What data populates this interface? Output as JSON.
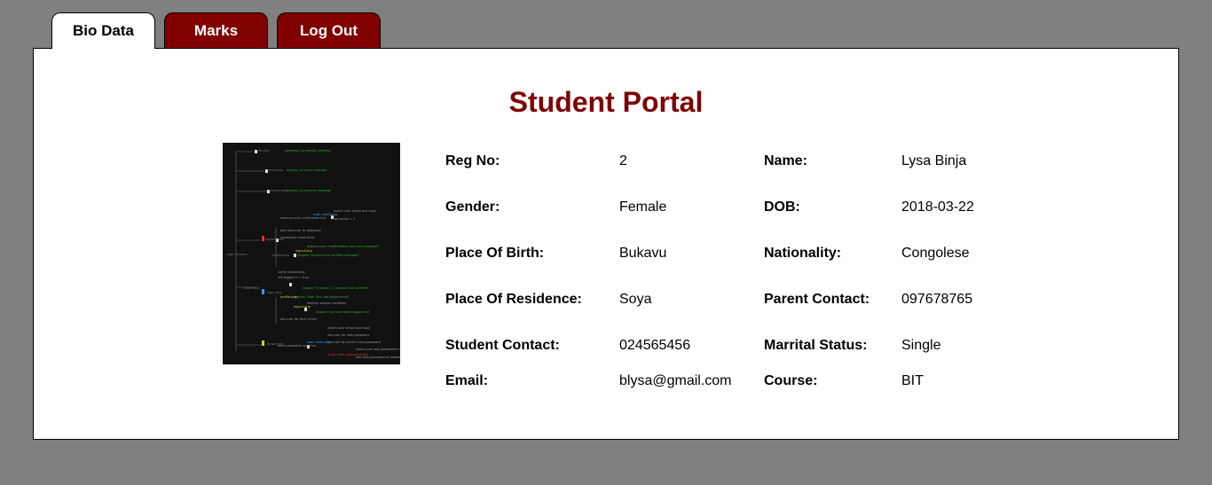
{
  "tabs": [
    {
      "label": "Bio Data",
      "active": true
    },
    {
      "label": "Marks",
      "active": false
    },
    {
      "label": "Log Out",
      "active": false
    }
  ],
  "colors": {
    "background": "#808080",
    "accent": "#800000",
    "panel": "#ffffff"
  },
  "page": {
    "title": "Student Portal"
  },
  "photo": {
    "icon": "student-photo-image"
  },
  "bio": {
    "reg_no": {
      "label": "Reg No:",
      "value": "2"
    },
    "name": {
      "label": "Name:",
      "value": "Lysa Binja"
    },
    "gender": {
      "label": "Gender:",
      "value": "Female"
    },
    "dob": {
      "label": "DOB:",
      "value": "2018-03-22"
    },
    "place_of_birth": {
      "label": "Place Of Birth:",
      "value": "Bukavu"
    },
    "nationality": {
      "label": "Nationality:",
      "value": "Congolese"
    },
    "place_of_residence": {
      "label": "Place Of Residence:",
      "value": "Soya"
    },
    "parent_contact": {
      "label": "Parent Contact:",
      "value": "097678765"
    },
    "student_contact": {
      "label": "Student Contact:",
      "value": "024565456"
    },
    "marital_status": {
      "label": "Marrital Status:",
      "value": "Single"
    },
    "email": {
      "label": "Email:",
      "value": "blysa@gmail.com"
    },
    "course": {
      "label": "Course:",
      "value": "BIT"
    }
  }
}
